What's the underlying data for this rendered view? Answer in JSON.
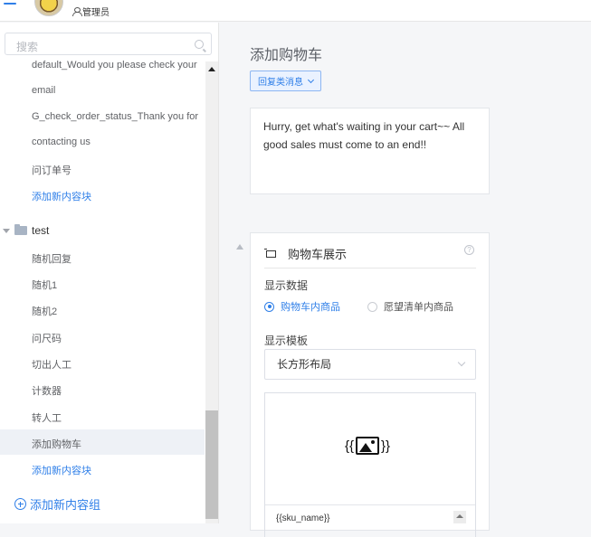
{
  "header": {
    "role_label": "管理员"
  },
  "sidebar": {
    "search_placeholder": "搜索",
    "items": [
      {
        "label": "default_Would you please check your",
        "link": false
      },
      {
        "label": "email",
        "link": false
      },
      {
        "label": "G_check_order_status_Thank you for",
        "link": false
      },
      {
        "label": "contacting us",
        "link": false
      },
      {
        "label": "问订单号",
        "link": false
      },
      {
        "label": "添加新内容块",
        "link": true
      }
    ],
    "folder": {
      "label": "test",
      "children": [
        {
          "label": "随机回复"
        },
        {
          "label": "随机1"
        },
        {
          "label": "随机2"
        },
        {
          "label": "问尺码"
        },
        {
          "label": "切出人工"
        },
        {
          "label": "计数器"
        },
        {
          "label": "转人工"
        },
        {
          "label": "添加购物车",
          "active": true
        }
      ],
      "add_label": "添加新内容块"
    },
    "add_group_label": "添加新内容组"
  },
  "main": {
    "title": "添加购物车",
    "reply_dropdown": "回复类消息",
    "message_text": "Hurry, get what's waiting in your cart~~ All good sales must come to an end!!",
    "card": {
      "title": "购物车展示",
      "data_label": "显示数据",
      "radio_options": [
        {
          "label": "购物车内商品",
          "selected": true
        },
        {
          "label": "愿望清单内商品",
          "selected": false
        }
      ],
      "template_label": "显示模板",
      "template_value": "长方形布局",
      "image_open_brace": "{{",
      "image_close_brace": "}}",
      "sku_placeholder": "{{sku_name}}"
    }
  },
  "colors": {
    "accent": "#2f7fe8",
    "active_row": "#eef1f6"
  }
}
